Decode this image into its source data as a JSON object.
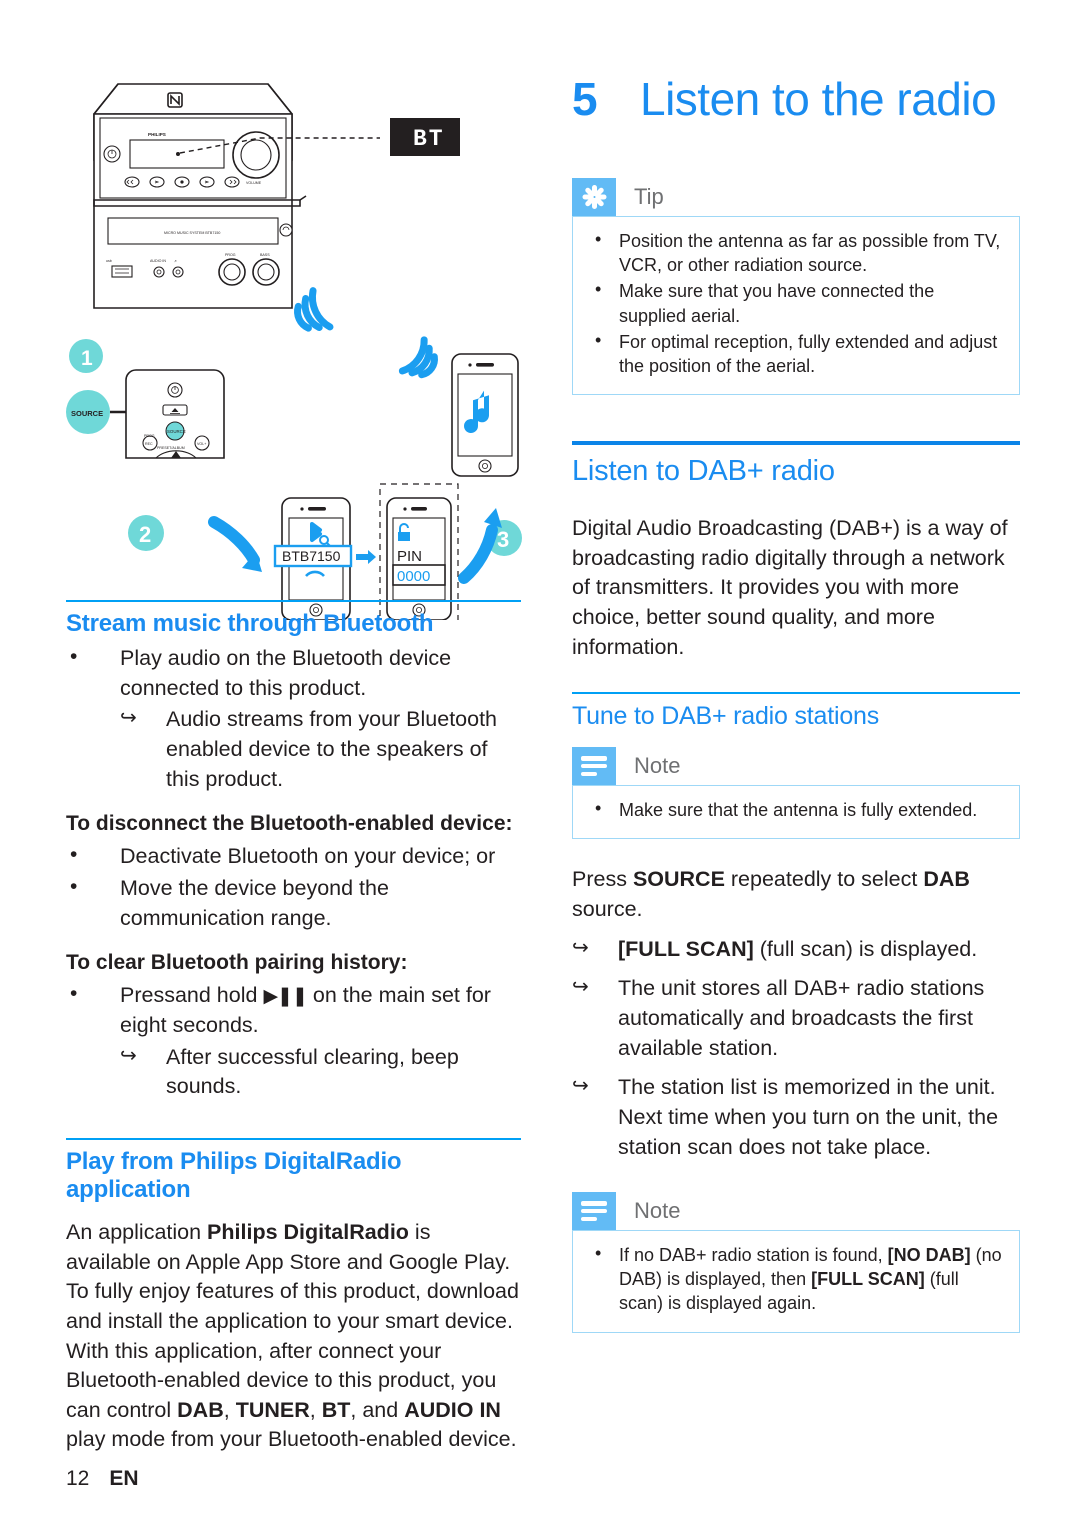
{
  "chapter": {
    "number": "5",
    "title": "Listen to the radio"
  },
  "colors": {
    "accent_blue": "#1a8cf0",
    "rule_blue": "#0b84e8",
    "callout_icon_bg": "#62bbf5",
    "callout_border": "#9fd8f7",
    "step_badge": "#6fd8d8",
    "illustration_blue": "#1b9ef0"
  },
  "tip_callout": {
    "label": "Tip",
    "icon": "asterisk-icon",
    "items": [
      "Position the antenna as far as possible from TV, VCR, or other radiation source.",
      "Make sure that you have connected the supplied aerial.",
      "For optimal reception, fully extended and adjust the position of the aerial."
    ]
  },
  "dab_section": {
    "heading": "Listen to DAB+ radio",
    "paragraph": "Digital Audio Broadcasting (DAB+) is a way of broadcasting radio digitally through a network of transmitters. It provides you with more choice, better sound quality, and more information."
  },
  "tune_section": {
    "heading": "Tune to DAB+ radio stations",
    "note_callout": {
      "label": "Note",
      "icon": "note-lines-icon",
      "items": [
        "Make sure that the antenna is fully extended."
      ]
    },
    "instruction": {
      "pre": "Press ",
      "bold1": "SOURCE",
      "mid": " repeatedly to select ",
      "bold2": "DAB",
      "post": " source."
    },
    "results": [
      {
        "bold": "[FULL SCAN]",
        "rest": " (full scan) is displayed."
      },
      {
        "bold": "",
        "rest": "The unit stores all DAB+ radio stations automatically and broadcasts the first available station."
      },
      {
        "bold": "",
        "rest": "The station list is memorized in the unit. Next time when you turn on the unit, the station scan does not take place."
      }
    ],
    "note_callout_2": {
      "label": "Note",
      "icon": "note-lines-icon",
      "item_parts": {
        "p1": "If no DAB+ radio station is found, ",
        "b1": "[NO DAB]",
        "p2": " (no DAB) is displayed, then ",
        "b2": "[FULL SCAN]",
        "p3": " (full scan) is displayed again."
      }
    }
  },
  "bluetooth_section": {
    "heading": "Stream music through Bluetooth",
    "bullets": [
      "Play audio on the Bluetooth device connected to this product."
    ],
    "sub_arrows": [
      "Audio streams from your Bluetooth enabled device to the speakers of this product."
    ],
    "disconnect_heading": "To disconnect the Bluetooth-enabled device:",
    "disconnect_bullets": [
      "Deactivate Bluetooth on your device; or",
      "Move the device beyond the communication range."
    ],
    "clear_heading": "To clear Bluetooth pairing history:",
    "clear_bullet_parts": {
      "p1": "Pressand hold ",
      "glyph": "▶❚❚",
      "p2": " on the main set for eight seconds."
    },
    "clear_arrow": "After successful clearing, beep sounds."
  },
  "app_section": {
    "heading": "Play from Philips DigitalRadio application",
    "para1_parts": {
      "p1": "An application ",
      "b1": "Philips DigitalRadio",
      "p2": " is available on Apple App Store and Google Play."
    },
    "para2_parts": {
      "p1": "To fully enjoy features of this product, download and install the application to your smart device. With this application, after connect your Bluetooth-enabled device to this product, you can control ",
      "b1": "DAB",
      "p2": ", ",
      "b2": "TUNER",
      "p3": ", ",
      "b3": "BT",
      "p4": ", and ",
      "b4": "AUDIO IN",
      "p5": " play mode from your Bluetooth-enabled device."
    }
  },
  "illustration": {
    "brand_label": "PHILIPS",
    "display_badge": "BT",
    "unit_model_text": "MICRO MUSIC SYSTEM BTB7150",
    "nfc_icon": "nfc-icon",
    "volume_label": "VOLUME",
    "jack_labels": {
      "usb": "usb-icon",
      "audio_in": "AUDIO IN",
      "headphone": "headphone-icon"
    },
    "remote": {
      "power_icon": "power-icon",
      "eject_icon": "eject-icon",
      "source_button": "SOURCE",
      "preset_album_label": "PRESET/ALBUM",
      "left_label": "PROG",
      "right_label": "VOL"
    },
    "callout_bubble": "SOURCE",
    "steps": [
      "1",
      "2",
      "3"
    ],
    "phone_pairing": {
      "device_name": "BTB7150",
      "pin_label": "PIN",
      "pin_value": "0000",
      "bluetooth_icon": "bluetooth-search-icon",
      "lock_icon": "lock-icon",
      "music_note_icon": "music-note-icon"
    }
  },
  "footer": {
    "page_number": "12",
    "language": "EN"
  }
}
